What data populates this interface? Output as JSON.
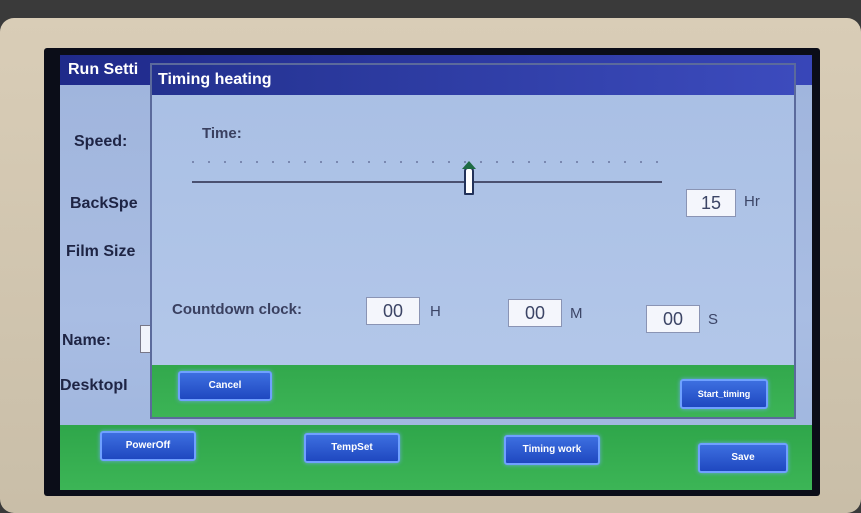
{
  "background_window": {
    "title": "Run Setti",
    "labels": {
      "speed": "Speed:",
      "backspeed": "BackSpe",
      "film_size": "Film Size",
      "name": "Name:",
      "desktop": "DesktopI"
    },
    "buttons": {
      "poweroff": "PowerOff",
      "tempset": "TempSet",
      "timing_work": "Timing work",
      "save": "Save"
    }
  },
  "dialog": {
    "title": "Timing heating",
    "time_label": "Time:",
    "time_slider_value": 15,
    "time_slider_fraction": 0.59,
    "time_value": "15",
    "time_unit": "Hr",
    "countdown_label": "Countdown clock:",
    "hours": "00",
    "hours_unit": "H",
    "minutes": "00",
    "minutes_unit": "M",
    "seconds": "00",
    "seconds_unit": "S",
    "cancel_label": "Cancel",
    "start_label": "Start_timing"
  },
  "colors": {
    "title_bar": "#23318f",
    "panel": "#a9bfe4",
    "green_bar": "#35ad50",
    "button": "#2a58d0"
  }
}
